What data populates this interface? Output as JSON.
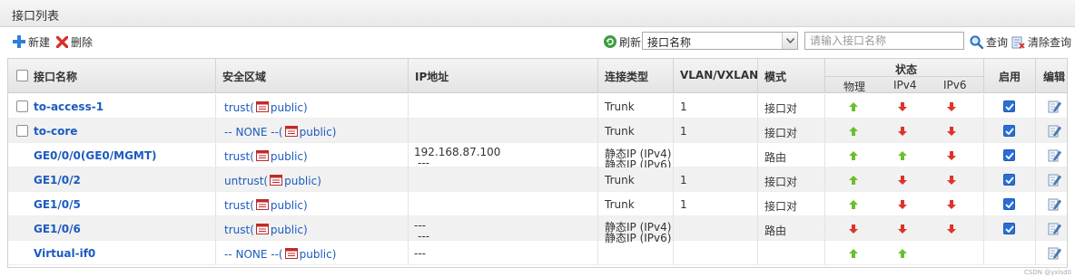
{
  "panel": {
    "title": "接口列表"
  },
  "toolbar": {
    "new_label": "新建",
    "delete_label": "删除",
    "refresh_label": "刷新",
    "search_field_value": "接口名称",
    "search_placeholder": "请输入接口名称",
    "query_label": "查询",
    "clear_label": "清除查询"
  },
  "table": {
    "headers": {
      "name": "接口名称",
      "zone": "安全区域",
      "ip": "IP地址",
      "conn": "连接类型",
      "vlan": "VLAN/VXLAN",
      "mode": "模式",
      "status": "状态",
      "physical": "物理",
      "ipv4": "IPv4",
      "ipv6": "IPv6",
      "enable": "启用",
      "edit": "编辑"
    },
    "rows": [
      {
        "name": "to-access-1",
        "zone_prefix": "trust(",
        "zone_suffix": "public)",
        "ip1": "",
        "ip2": "",
        "conn1": "Trunk",
        "conn2": "",
        "vlan": "1",
        "mode": "接口对",
        "physical": "up",
        "ipv4": "down",
        "ipv6": "down",
        "enabled": true,
        "checkbox": true
      },
      {
        "name": "to-core",
        "zone_prefix": "-- NONE --(",
        "zone_suffix": "public)",
        "ip1": "",
        "ip2": "",
        "conn1": "Trunk",
        "conn2": "",
        "vlan": "1",
        "mode": "接口对",
        "physical": "up",
        "ipv4": "down",
        "ipv6": "down",
        "enabled": true,
        "checkbox": true
      },
      {
        "name": "GE0/0/0(GE0/MGMT)",
        "zone_prefix": "trust(",
        "zone_suffix": "public)",
        "ip1": "192.168.87.100",
        "ip2": "---",
        "conn1": "静态IP (IPv4)",
        "conn2": "静态IP (IPv6)",
        "vlan": "",
        "mode": "路由",
        "physical": "up",
        "ipv4": "up",
        "ipv6": "down",
        "enabled": true,
        "checkbox": false
      },
      {
        "name": "GE1/0/2",
        "zone_prefix": "untrust(",
        "zone_suffix": "public)",
        "ip1": "",
        "ip2": "",
        "conn1": "Trunk",
        "conn2": "",
        "vlan": "1",
        "mode": "接口对",
        "physical": "up",
        "ipv4": "down",
        "ipv6": "down",
        "enabled": true,
        "checkbox": false
      },
      {
        "name": "GE1/0/5",
        "zone_prefix": "trust(",
        "zone_suffix": "public)",
        "ip1": "",
        "ip2": "",
        "conn1": "Trunk",
        "conn2": "",
        "vlan": "1",
        "mode": "接口对",
        "physical": "up",
        "ipv4": "down",
        "ipv6": "down",
        "enabled": true,
        "checkbox": false
      },
      {
        "name": "GE1/0/6",
        "zone_prefix": "trust(",
        "zone_suffix": "public)",
        "ip1": "---",
        "ip2": "---",
        "conn1": "静态IP (IPv4)",
        "conn2": "静态IP (IPv6)",
        "vlan": "",
        "mode": "路由",
        "physical": "down",
        "ipv4": "down",
        "ipv6": "down",
        "enabled": true,
        "checkbox": false
      },
      {
        "name": "Virtual-if0",
        "zone_prefix": "-- NONE --(",
        "zone_suffix": "public)",
        "ip1": "---",
        "ip2": "",
        "conn1": "",
        "conn2": "",
        "vlan": "",
        "mode": "",
        "physical": "up",
        "ipv4": "up",
        "ipv6": "",
        "enabled": false,
        "checkbox": false
      }
    ]
  },
  "colors": {
    "link": "#1c5bbf",
    "up": "#6cbf2c",
    "down": "#e0322a",
    "checked": "#2a6fd6"
  },
  "footer": "CSDN @yxlsd0"
}
